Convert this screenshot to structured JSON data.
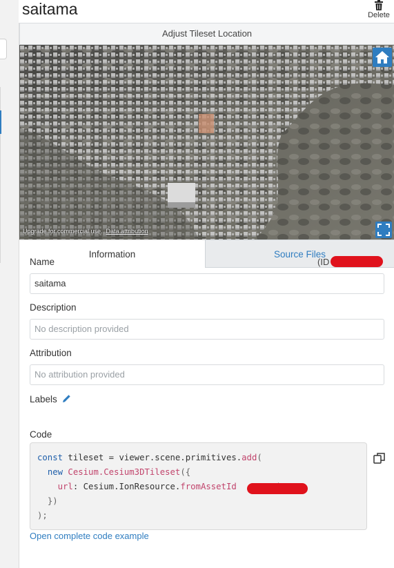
{
  "header": {
    "title": "saitama",
    "delete_label": "Delete"
  },
  "adjust_button": "Adjust Tileset Location",
  "map": {
    "credits_text": "Upgrade for commercial use.",
    "data_attribution": "Data attribution"
  },
  "tabs": [
    {
      "label": "Information",
      "active": true
    },
    {
      "label": "Source Files",
      "active": false
    }
  ],
  "info": {
    "name_label": "Name",
    "id_prefix": "(ID",
    "id_suffix": ")",
    "name_value": "saitama",
    "description_label": "Description",
    "description_placeholder": "No description provided",
    "attribution_label": "Attribution",
    "attribution_placeholder": "No attribution provided",
    "labels_label": "Labels",
    "code_label": "Code",
    "code": {
      "line1_kw": "const",
      "line1_a": " tileset = viewer.scene.primitives.",
      "line1_fn": "add",
      "line1_b": "(",
      "line2_kw": "new",
      "line2_fn": " Cesium.Cesium3DTileset",
      "line2_b": "({",
      "line3_key": "url",
      "line3_a": ": Cesium.IonResource.",
      "line3_fn": "fromAssetId",
      "line3_b": "),",
      "line4": "})",
      "line5": ");"
    },
    "open_example_link": "Open complete code example"
  },
  "colors": {
    "accent": "#2f7dc0",
    "redaction": "#e0121c"
  }
}
